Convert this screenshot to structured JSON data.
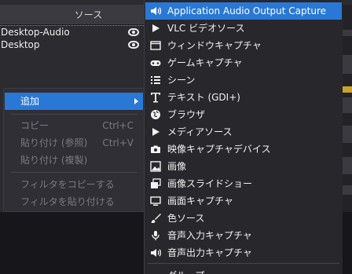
{
  "sources_panel": {
    "title": "ソース",
    "items": [
      {
        "label": "Desktop-Audio"
      },
      {
        "label": "Desktop"
      }
    ]
  },
  "context_menu": {
    "add_label": "追加",
    "copy_label": "コピー",
    "copy_shortcut": "Ctrl+C",
    "paste_ref_label": "貼り付け (参照)",
    "paste_ref_shortcut": "Ctrl+V",
    "paste_dup_label": "貼り付け (複製)",
    "copy_filters_label": "フィルタをコピーする",
    "paste_filters_label": "フィルタを貼り付ける"
  },
  "add_submenu": {
    "items": [
      {
        "label": "Application Audio Output Capture",
        "icon": "speaker-icon"
      },
      {
        "label": "VLC ビデオソース",
        "icon": "play-icon"
      },
      {
        "label": "ウィンドウキャプチャ",
        "icon": "window-icon"
      },
      {
        "label": "ゲームキャプチャ",
        "icon": "gamepad-icon"
      },
      {
        "label": "シーン",
        "icon": "list-icon"
      },
      {
        "label": "テキスト (GDI+)",
        "icon": "text-icon"
      },
      {
        "label": "ブラウザ",
        "icon": "globe-icon"
      },
      {
        "label": "メディアソース",
        "icon": "play-icon"
      },
      {
        "label": "映像キャプチャデバイス",
        "icon": "camera-icon"
      },
      {
        "label": "画像",
        "icon": "image-icon"
      },
      {
        "label": "画像スライドショー",
        "icon": "slideshow-icon"
      },
      {
        "label": "画面キャプチャ",
        "icon": "monitor-icon"
      },
      {
        "label": "色ソース",
        "icon": "brush-icon"
      },
      {
        "label": "音声入力キャプチャ",
        "icon": "microphone-icon"
      },
      {
        "label": "音声出力キャプチャ",
        "icon": "speaker-icon"
      }
    ],
    "partial_label": "グループ"
  },
  "colors": {
    "accent": "#2a78d6",
    "menu_bg": "#27272c",
    "panel_bg": "#2b2b30"
  }
}
